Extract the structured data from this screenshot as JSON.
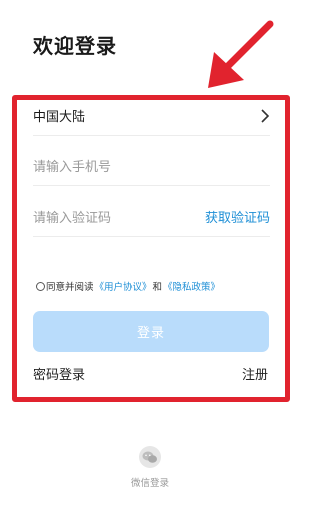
{
  "page": {
    "title": "欢迎登录"
  },
  "form": {
    "region_label": "中国大陆",
    "phone_placeholder": "请输入手机号",
    "code_placeholder": "请输入验证码",
    "get_code_label": "获取验证码",
    "agreement": {
      "prefix": "同意并阅读",
      "user_agreement": "《用户协议》",
      "and": "和",
      "privacy_policy": "《隐私政策》",
      "checked": false
    },
    "login_label": "登录",
    "password_login_label": "密码登录",
    "register_label": "注册"
  },
  "third_party": {
    "wechat_label": "微信登录",
    "wechat_icon": "wechat-icon"
  },
  "colors": {
    "annotation_red": "#e1232e",
    "link_blue": "#1e8fd6",
    "button_disabled": "#b9dcfb"
  }
}
